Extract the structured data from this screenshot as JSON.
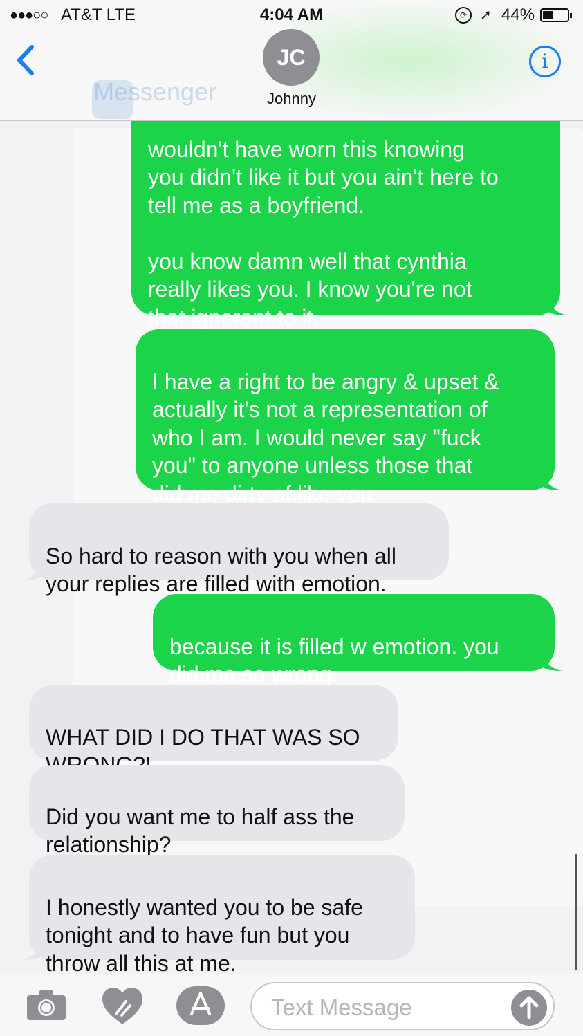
{
  "status_bar": {
    "signal": "●●●○○",
    "carrier": "AT&T  LTE",
    "time": "4:04 AM",
    "battery_percent": "44%",
    "battery_level": 0.44
  },
  "header": {
    "avatar_initials": "JC",
    "contact_name": "Johnny",
    "info_label": "i",
    "ghost_app_label": "Messenger"
  },
  "messages": [
    {
      "sender": "me",
      "text": "wouldn't have worn this knowing\nyou didn't like it but you ain't here to\ntell me as a boyfriend.\n\nyou know damn well that cynthia\nreally likes you. I know you're not\nthat ignorant to it."
    },
    {
      "sender": "me",
      "text": "I have a right to be angry & upset &\nactually it's not a representation of\nwho I am. I would never say \"fuck\nyou\" to anyone unless those that\ndid me dirty af like you"
    },
    {
      "sender": "them",
      "text": "So hard to reason with you when all\nyour replies are filled with emotion."
    },
    {
      "sender": "me",
      "text": "because it is filled w emotion. you\ndid me so wrong."
    },
    {
      "sender": "them",
      "text": "WHAT DID I DO THAT WAS SO\nWRONG?!"
    },
    {
      "sender": "them",
      "text": "Did you want me to half ass the\nrelationship?"
    },
    {
      "sender": "them",
      "text": "I honestly wanted you to be safe\ntonight and to have fun but you\nthrow all this at me."
    }
  ],
  "composer": {
    "placeholder": "Text Message"
  },
  "colors": {
    "sent_bubble": "#1bd44a",
    "received_bubble": "#e5e5ea",
    "accent": "#1a7ef6"
  },
  "icons": [
    "chevron-left-icon",
    "info-icon",
    "camera-icon",
    "digital-touch-heart-icon",
    "app-store-icon",
    "send-arrow-icon",
    "location-icon",
    "orientation-lock-icon",
    "battery-icon"
  ]
}
